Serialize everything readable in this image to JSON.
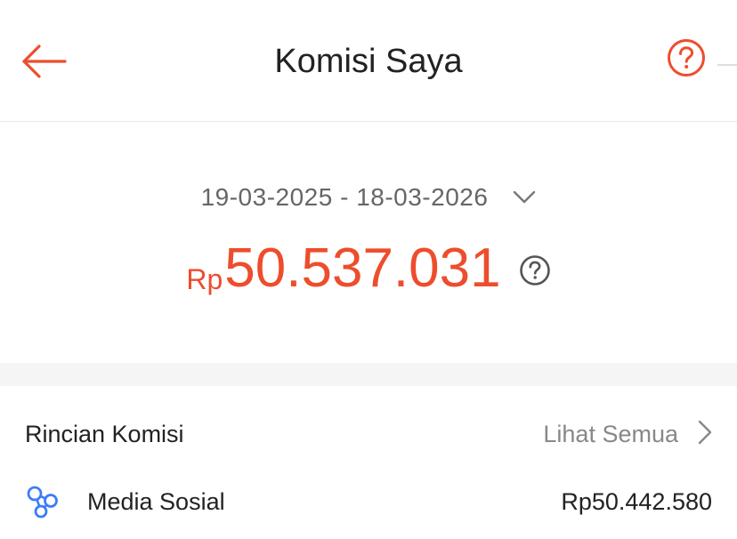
{
  "header": {
    "title": "Komisi Saya",
    "back_icon": "arrow-left-icon",
    "help_icon": "question-circle-icon"
  },
  "summary": {
    "date_range": "19-03-2025 - 18-03-2026",
    "currency_prefix": "Rp",
    "total_amount": "50.537.031",
    "amount_color": "#ee4d2d"
  },
  "details": {
    "title": "Rincian Komisi",
    "see_all_label": "Lihat Semua",
    "items": [
      {
        "icon": "share-network-icon",
        "label": "Media Sosial",
        "value": "Rp50.442.580"
      }
    ]
  },
  "colors": {
    "accent": "#ee4d2d",
    "icon_blue": "#3d7df6",
    "muted_text": "#888888"
  }
}
